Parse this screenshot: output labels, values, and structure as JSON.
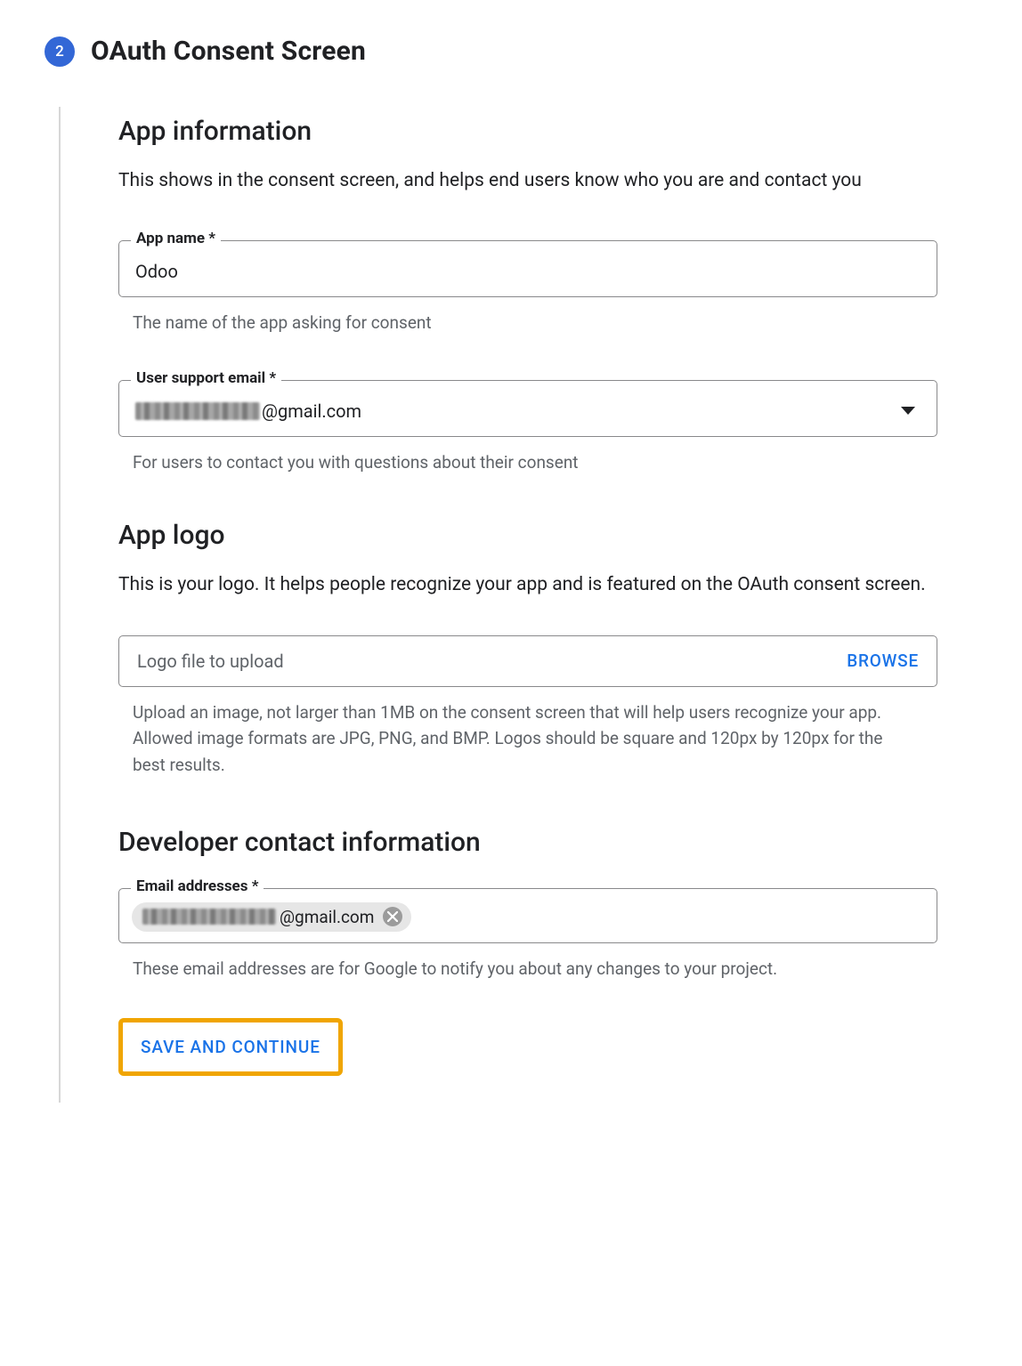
{
  "step": {
    "number": "2",
    "title": "OAuth Consent Screen"
  },
  "appInfo": {
    "heading": "App information",
    "description": "This shows in the consent screen, and helps end users know who you are and contact you",
    "appName": {
      "label": "App name *",
      "value": "Odoo",
      "helper": "The name of the app asking for consent"
    },
    "supportEmail": {
      "label": "User support email *",
      "domain": "@gmail.com",
      "helper": "For users to contact you with questions about their consent"
    }
  },
  "appLogo": {
    "heading": "App logo",
    "description": "This is your logo. It helps people recognize your app and is featured on the OAuth consent screen.",
    "placeholder": "Logo file to upload",
    "browse": "BROWSE",
    "helper": "Upload an image, not larger than 1MB on the consent screen that will help users recognize your app. Allowed image formats are JPG, PNG, and BMP. Logos should be square and 120px by 120px for the best results."
  },
  "devContact": {
    "heading": "Developer contact information",
    "label": "Email addresses *",
    "chipDomain": "@gmail.com",
    "helper": "These email addresses are for Google to notify you about any changes to your project."
  },
  "saveButton": "SAVE AND CONTINUE"
}
